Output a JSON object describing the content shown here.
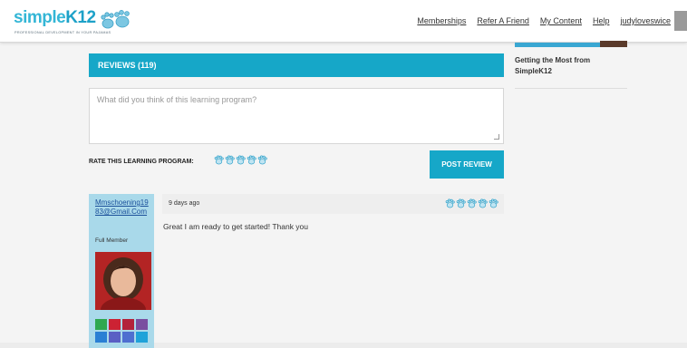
{
  "brand": {
    "name_part1": "simple",
    "name_part2": "K12",
    "tagline": "PROFESSIONAL DEVELOPMENT IN YOUR PAJAMAS",
    "accent_color": "#16a7c8"
  },
  "nav": {
    "items": [
      "Memberships",
      "Refer A Friend",
      "My Content",
      "Help",
      "judyloveswice"
    ]
  },
  "sidebar": {
    "related_title": "Getting the Most from SimpleK12"
  },
  "reviews": {
    "header": "REVIEWS (119)",
    "placeholder": "What did you think of this learning program?",
    "rate_label": "RATE THIS LEARNING PROGRAM:",
    "rating_icons": 5,
    "post_label": "POST REVIEW"
  },
  "review_item": {
    "user_email": "Mmschoening1983@Gmail.Com",
    "user_role": "Full Member",
    "date": "9 days ago",
    "rating": 5,
    "text": "Great I am ready to get started! Thank you",
    "badge_colors": [
      "#2fa84f",
      "#cc2233",
      "#b3233a",
      "#7a4fa0",
      "#2a7fd4",
      "#5a5fc4",
      "#4e6fd0",
      "#1fa2d9"
    ]
  }
}
